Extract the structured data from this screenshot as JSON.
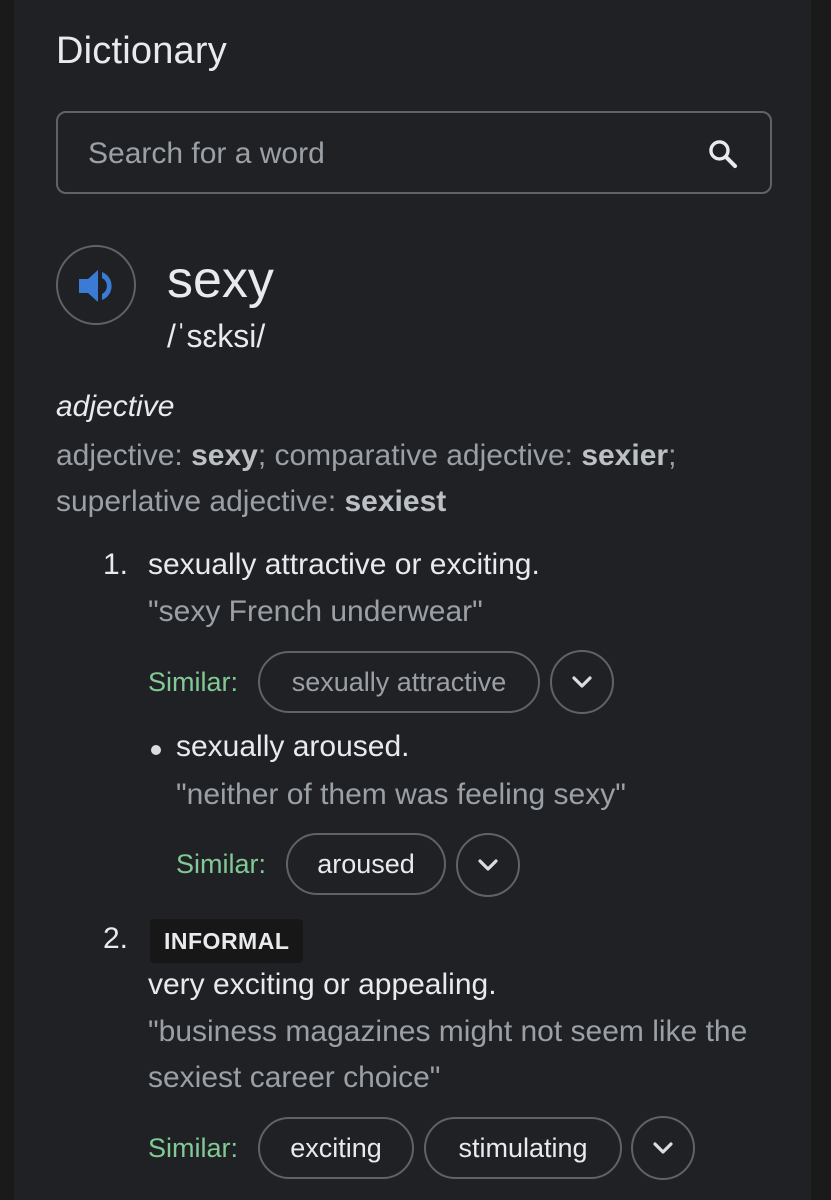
{
  "header": {
    "title": "Dictionary"
  },
  "search": {
    "placeholder": "Search for a word",
    "value": "",
    "icon": "search-icon"
  },
  "entry": {
    "word": "sexy",
    "phonetic": "/ˈsɛksi/",
    "audio_icon": "speaker-icon",
    "part_of_speech": "adjective",
    "forms": [
      {
        "label": "adjective: ",
        "value": "sexy",
        "sep": "; "
      },
      {
        "label": "comparative adjective: ",
        "value": "sexier",
        "sep": ";"
      },
      {
        "label": "superlative adjective: ",
        "value": "sexiest",
        "sep": ""
      }
    ],
    "senses": [
      {
        "number": "1.",
        "definition": "sexually attractive or exciting.",
        "example": "\"sexy French underwear\"",
        "similar_label": "Similar:",
        "similar": [
          "sexually attractive"
        ],
        "subsenses": [
          {
            "definition": "sexually aroused.",
            "example": "\"neither of them was feeling sexy\"",
            "similar_label": "Similar:",
            "similar": [
              "aroused"
            ]
          }
        ]
      },
      {
        "number": "2.",
        "label": "INFORMAL",
        "definition": "very exciting or appealing.",
        "example": "\"business magazines might not seem like the sexiest career choice\"",
        "similar_label": "Similar:",
        "similar": [
          "exciting",
          "stimulating"
        ]
      }
    ]
  },
  "colors": {
    "background": "#202124",
    "accent_similar": "#81c995",
    "speaker": "#3a7bd5"
  }
}
